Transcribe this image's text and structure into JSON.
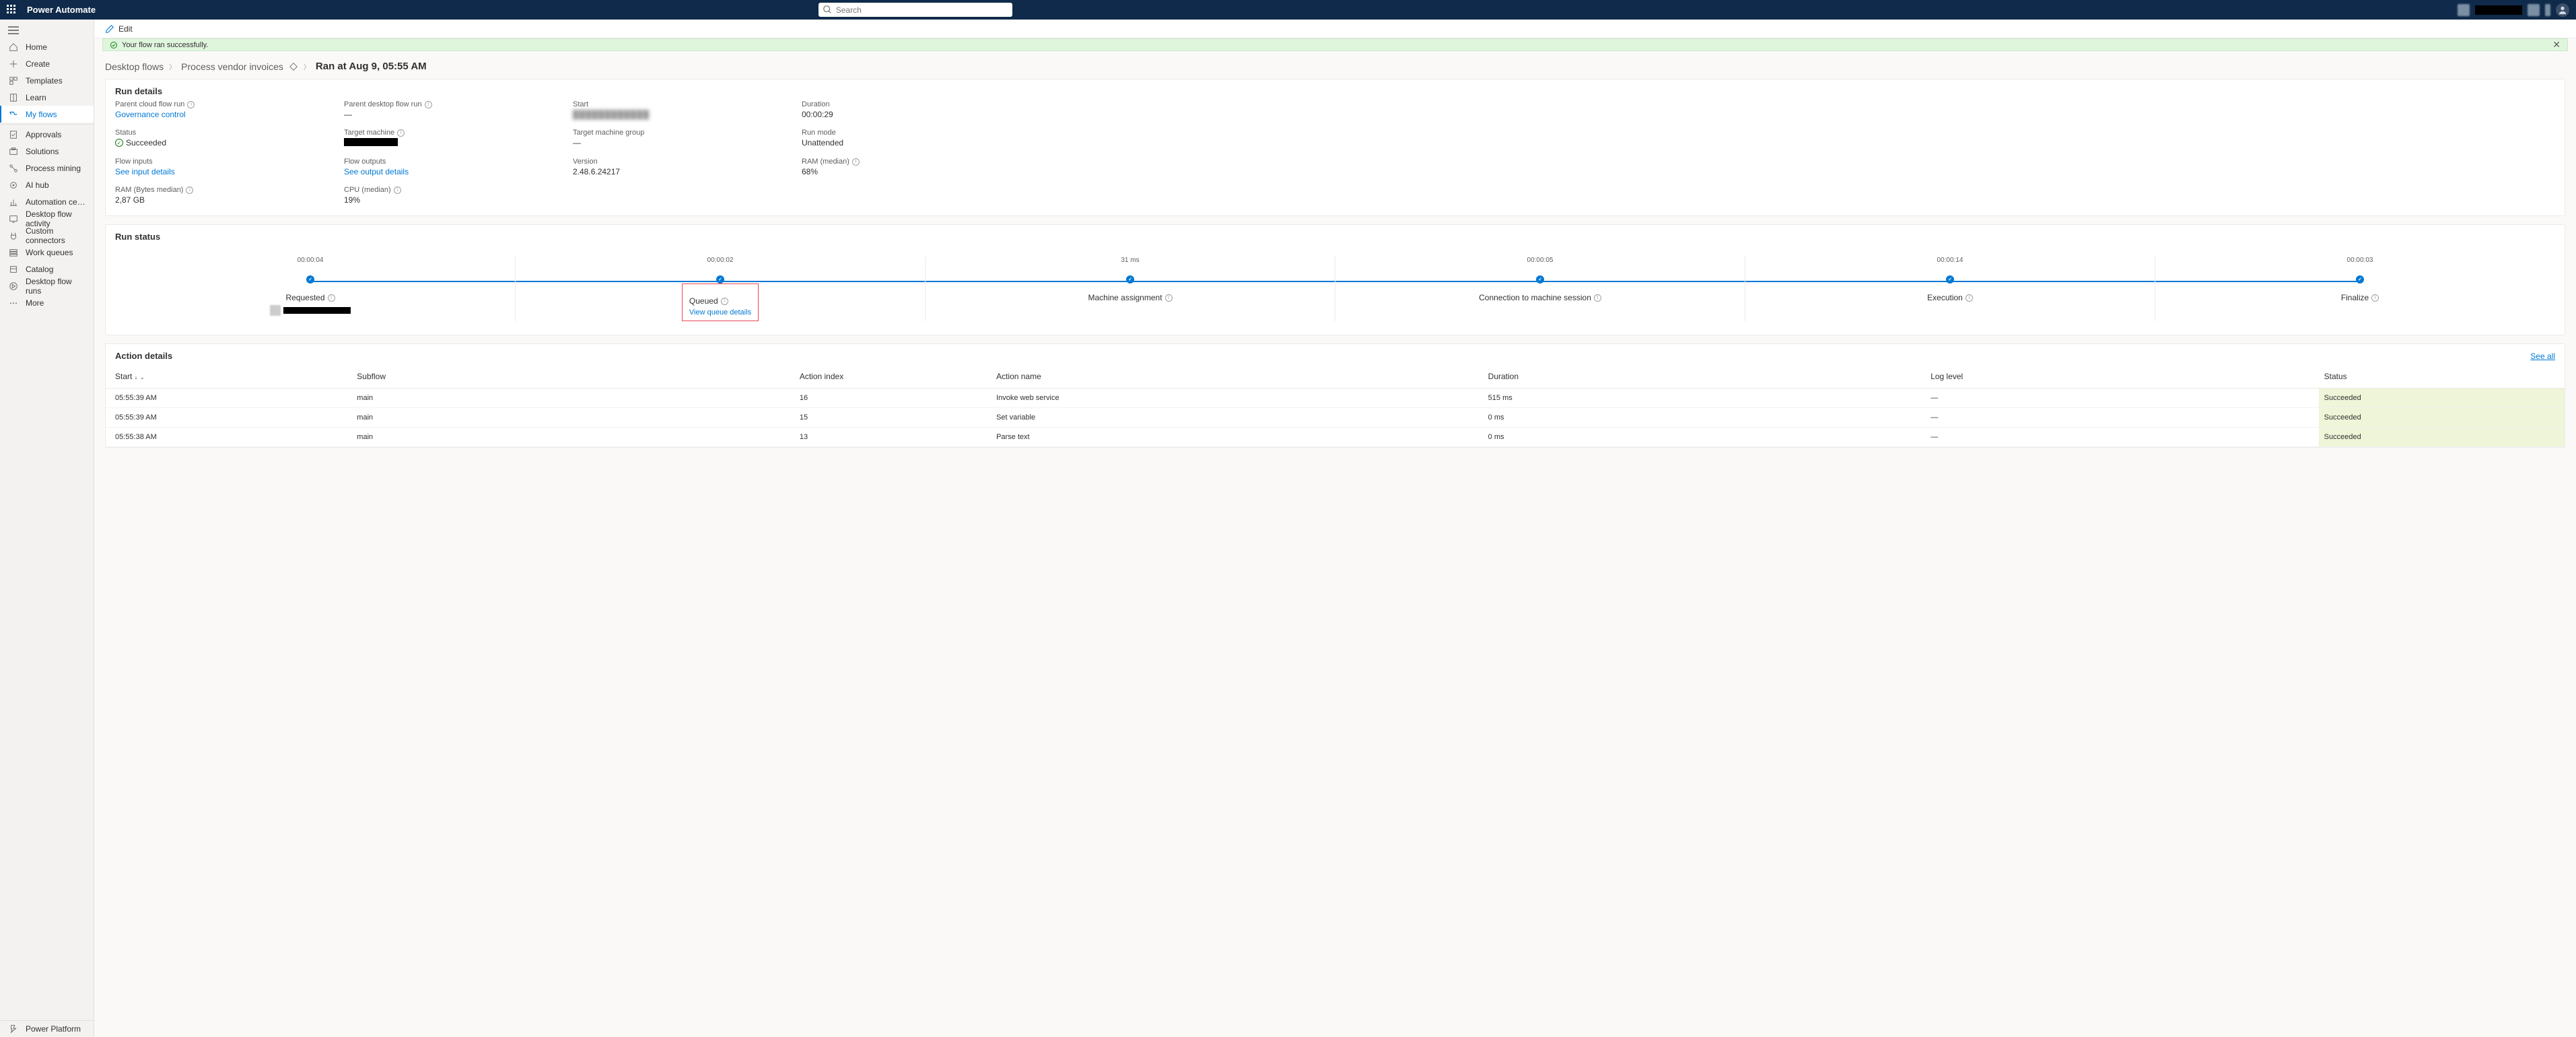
{
  "topbar": {
    "brand": "Power Automate",
    "search_placeholder": "Search"
  },
  "nav": {
    "items": [
      {
        "label": "Home"
      },
      {
        "label": "Create"
      },
      {
        "label": "Templates"
      },
      {
        "label": "Learn"
      },
      {
        "label": "My flows"
      },
      {
        "label": "Approvals"
      },
      {
        "label": "Solutions"
      },
      {
        "label": "Process mining"
      },
      {
        "label": "AI hub"
      },
      {
        "label": "Automation center (previe..."
      },
      {
        "label": "Desktop flow activity"
      },
      {
        "label": "Custom connectors"
      },
      {
        "label": "Work queues"
      },
      {
        "label": "Catalog"
      },
      {
        "label": "Desktop flow runs"
      },
      {
        "label": "More"
      }
    ],
    "power_platform": "Power Platform"
  },
  "cmd": {
    "edit": "Edit"
  },
  "notification": {
    "msg": "Your flow ran successfully."
  },
  "breadcrumb": {
    "b1": "Desktop flows",
    "b2": "Process vendor invoices",
    "ran": "Ran at Aug 9, 05:55 AM"
  },
  "rundetails": {
    "title": "Run details",
    "parent_cloud_label": "Parent cloud flow run",
    "parent_cloud_value": "Governance control",
    "parent_desktop_label": "Parent desktop flow run",
    "parent_desktop_value": "—",
    "start_label": "Start",
    "duration_label": "Duration",
    "duration_value": "00:00:29",
    "status_label": "Status",
    "status_value": "Succeeded",
    "target_machine_label": "Target machine",
    "target_group_label": "Target machine group",
    "target_group_value": "—",
    "runmode_label": "Run mode",
    "runmode_value": "Unattended",
    "flowin_label": "Flow inputs",
    "flowin_value": "See input details",
    "flowout_label": "Flow outputs",
    "flowout_value": "See output details",
    "version_label": "Version",
    "version_value": "2.48.6.24217",
    "ram_median_label": "RAM (median)",
    "ram_median_value": "68%",
    "ram_bytes_label": "RAM (Bytes median)",
    "ram_bytes_value": "2,87 GB",
    "cpu_label": "CPU (median)",
    "cpu_value": "19%"
  },
  "runstatus": {
    "title": "Run status",
    "stages": [
      {
        "dur": "00:00:04",
        "label": "Requested"
      },
      {
        "dur": "00:00:02",
        "label": "Queued",
        "sub": "View queue details"
      },
      {
        "dur": "31 ms",
        "label": "Machine assignment"
      },
      {
        "dur": "00:00:05",
        "label": "Connection to machine session"
      },
      {
        "dur": "00:00:14",
        "label": "Execution"
      },
      {
        "dur": "00:00:03",
        "label": "Finalize"
      }
    ]
  },
  "actions": {
    "title": "Action details",
    "see_all": "See all",
    "cols": {
      "start": "Start",
      "subflow": "Subflow",
      "index": "Action index",
      "name": "Action name",
      "duration": "Duration",
      "log": "Log level",
      "status": "Status"
    },
    "rows": [
      {
        "start": "05:55:39 AM",
        "subflow": "main",
        "index": "16",
        "name": "Invoke web service",
        "duration": "515 ms",
        "log": "—",
        "status": "Succeeded"
      },
      {
        "start": "05:55:39 AM",
        "subflow": "main",
        "index": "15",
        "name": "Set variable",
        "duration": "0 ms",
        "log": "—",
        "status": "Succeeded"
      },
      {
        "start": "05:55:38 AM",
        "subflow": "main",
        "index": "13",
        "name": "Parse text",
        "duration": "0 ms",
        "log": "—",
        "status": "Succeeded"
      }
    ]
  }
}
